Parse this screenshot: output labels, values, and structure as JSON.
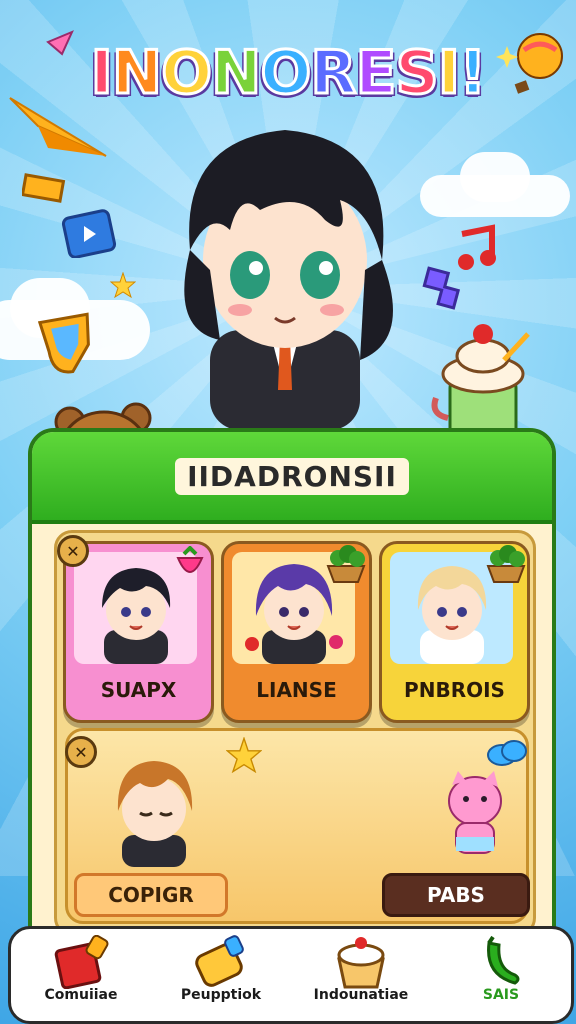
{
  "game_title": {
    "letters": [
      "I",
      "N",
      "O",
      "N",
      "O",
      "R",
      "E",
      "S",
      "I",
      "!"
    ],
    "colors": [
      "#ff4b6e",
      "#ff8a1e",
      "#ffd23a",
      "#7ad23a",
      "#3ab0ff",
      "#5a6cff",
      "#b04bff",
      "#ff4b6e",
      "#ffd23a",
      "#3ab0ff"
    ]
  },
  "panel": {
    "title": "IIDADRONSII"
  },
  "cards": [
    {
      "label": "SUAPX",
      "color": "#f08ad0",
      "frame": "#f7b6e2",
      "hair": "#1e1e2a",
      "has_x": true
    },
    {
      "label": "LIANSE",
      "color": "#f08b2e",
      "frame": "#ffd27a",
      "hair": "#5a3aa8",
      "has_x": false
    },
    {
      "label": "PNBROIS",
      "color": "#f7d43a",
      "frame": "#bde9ff",
      "hair": "#f3d79a",
      "has_x": false
    }
  ],
  "feature": {
    "left_button": "COPIGR",
    "right_button": "PABS"
  },
  "nav": [
    {
      "label": "Comuiiae",
      "icon": "red-book-icon",
      "color": "#1b1b1b"
    },
    {
      "label": "Peupptiok",
      "icon": "yellow-tube-icon",
      "color": "#1b1b1b"
    },
    {
      "label": "Indounatiae",
      "icon": "cupcake-icon",
      "color": "#1b1b1b"
    },
    {
      "label": "SAIS",
      "icon": "green-chili-icon",
      "color": "#2a9a1e"
    }
  ]
}
